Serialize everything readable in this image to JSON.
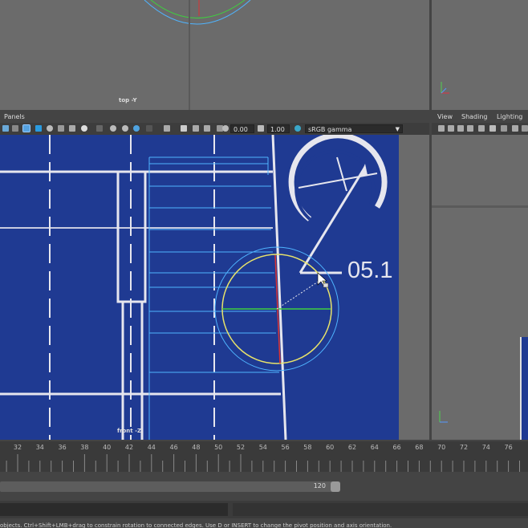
{
  "top_view": {
    "label": "top -Y"
  },
  "front_view": {
    "label": "front -Z"
  },
  "panel_menu": {
    "panels": "Panels"
  },
  "right_menu": {
    "view": "View",
    "shading": "Shading",
    "lighting": "Lighting"
  },
  "toolbar": {
    "exposure": "0.00",
    "gamma": "1.00",
    "color_space": "sRGB gamma"
  },
  "blueprint": {
    "dimension": "05.1"
  },
  "timeline": {
    "ticks": [
      "32",
      "34",
      "36",
      "38",
      "40",
      "42",
      "44",
      "46",
      "48",
      "50",
      "52",
      "54",
      "56",
      "58",
      "60",
      "62",
      "64",
      "66",
      "68",
      "70",
      "72",
      "74",
      "76"
    ]
  },
  "range": {
    "end": "120"
  },
  "help_line": "objects. Ctrl+Shift+LMB+drag to constrain rotation to connected edges. Use D or INSERT to change the pivot position and axis orientation.",
  "icons": [
    "camera-icon",
    "grid-icon",
    "wireframe-icon",
    "shaded-icon",
    "texture-icon",
    "light-icon",
    "isolate-icon",
    "gamma-icon",
    "color-space-icon",
    "dropdown-icon"
  ],
  "colors": {
    "blueprint": "#1f3a92",
    "accent_cyan": "#4fb4ff",
    "accent_yellow": "#e8e36a"
  }
}
